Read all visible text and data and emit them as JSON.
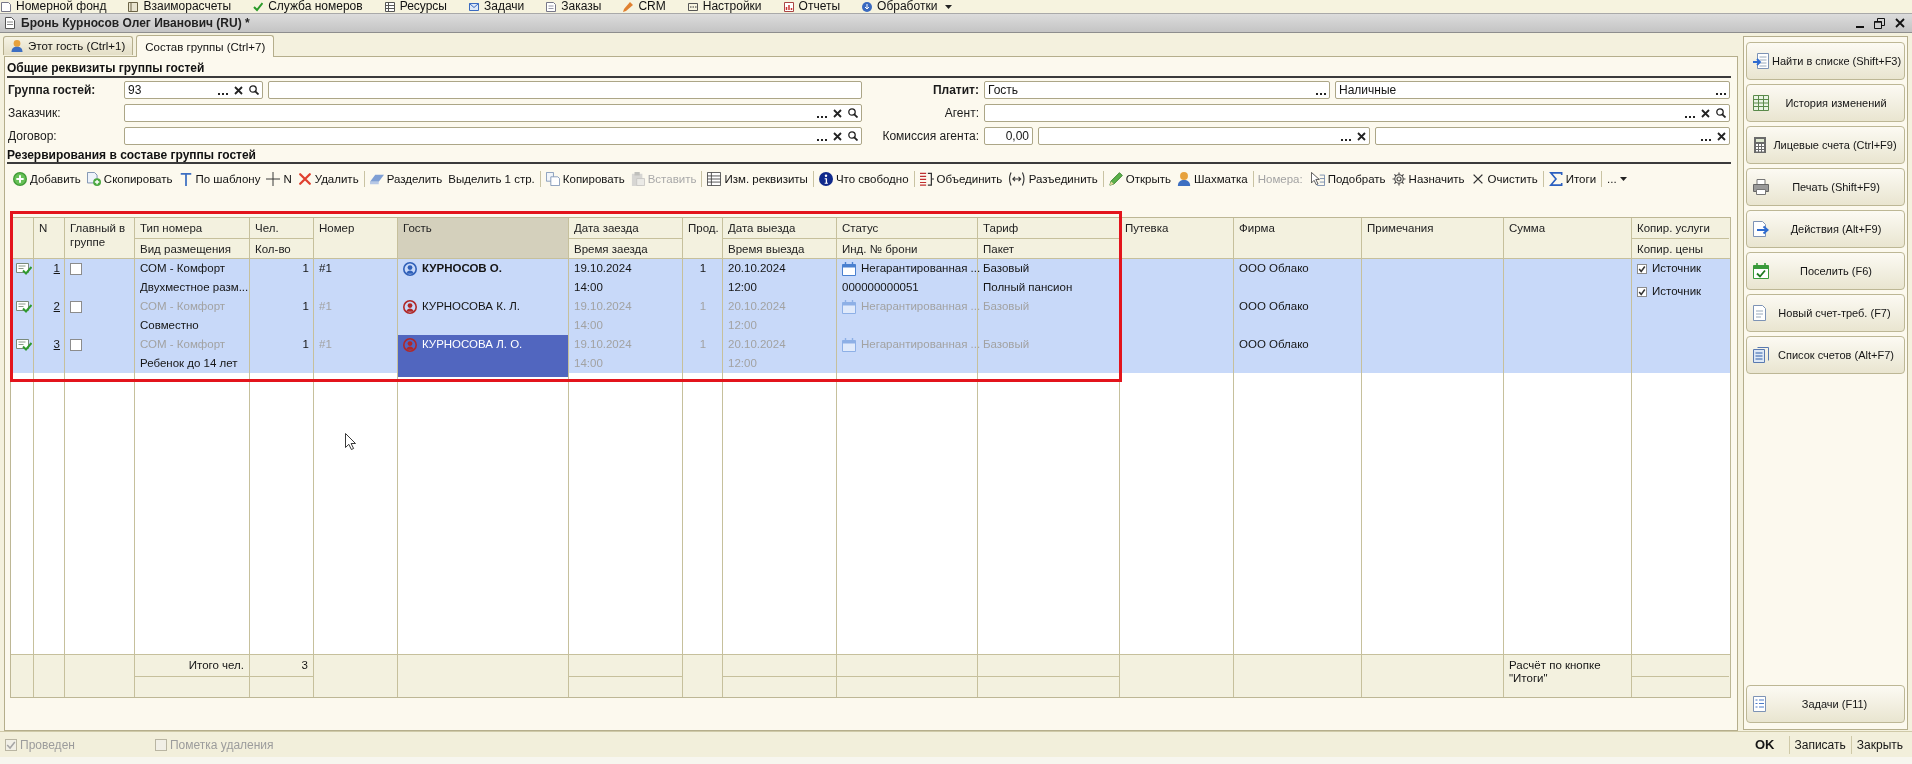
{
  "menu_bar": {
    "items": [
      {
        "label": "Номерной фонд"
      },
      {
        "label": "Взаиморасчеты"
      },
      {
        "label": "Служба номеров"
      },
      {
        "label": "Ресурсы"
      },
      {
        "label": "Задачи"
      },
      {
        "label": "Заказы"
      },
      {
        "label": "CRM"
      },
      {
        "label": "Настройки"
      },
      {
        "label": "Отчеты"
      },
      {
        "label": "Обработки"
      }
    ]
  },
  "window": {
    "title": "Бронь Курносов Олег Иванович (RU) *"
  },
  "tabs": [
    {
      "label": "Этот гость (Ctrl+1)",
      "selected": false
    },
    {
      "label": "Состав группы (Ctrl+7)",
      "selected": true
    }
  ],
  "group_details": {
    "title": "Общие реквизиты группы гостей",
    "left": [
      {
        "label": "Группа гостей:",
        "emphasized": true,
        "inputs": [
          {
            "kind": "lookup",
            "value": "93"
          },
          {
            "kind": "plain"
          }
        ]
      },
      {
        "label": "Заказчик:",
        "emphasized": false,
        "inputs": [
          {
            "kind": "lookup"
          }
        ]
      },
      {
        "label": "Договор:",
        "emphasized": false,
        "inputs": [
          {
            "kind": "lookup"
          }
        ]
      }
    ],
    "right": [
      {
        "label": "Платит:",
        "emphasized": true,
        "inputs": [
          {
            "kind": "select",
            "value": "Гость"
          },
          {
            "kind": "select",
            "value": "Наличные"
          }
        ]
      },
      {
        "label": "Агент:",
        "emphasized": false,
        "inputs": [
          {
            "kind": "lookup"
          }
        ]
      },
      {
        "label": "Комиссия агента:",
        "emphasized": false,
        "inputs": [
          {
            "kind": "number",
            "value": "0,00"
          },
          {
            "kind": "link"
          },
          {
            "kind": "link"
          }
        ]
      }
    ]
  },
  "reservations": {
    "title": "Резервирования в составе группы гостей",
    "toolbar": {
      "groups": [
        {
          "items": [
            {
              "kind": "button",
              "label": "Добавить",
              "disabled": false
            },
            {
              "kind": "button",
              "label": "Скопировать",
              "disabled": false
            },
            {
              "kind": "button",
              "label": "По шаблону",
              "disabled": false
            },
            {
              "kind": "button",
              "label": "N",
              "disabled": false
            },
            {
              "kind": "button",
              "label": "Удалить",
              "disabled": false
            }
          ]
        },
        {
          "items": [
            {
              "kind": "button",
              "label": "Разделить",
              "disabled": false
            },
            {
              "kind": "button",
              "label": "Выделить 1 стр.",
              "disabled": false
            }
          ]
        },
        {
          "items": [
            {
              "kind": "button",
              "label": "Копировать",
              "disabled": false
            },
            {
              "kind": "button",
              "label": "Вставить",
              "disabled": true
            }
          ]
        },
        {
          "items": [
            {
              "kind": "button",
              "label": "Изм. реквизиты",
              "disabled": false
            }
          ]
        },
        {
          "items": [
            {
              "kind": "button",
              "label": "Что свободно",
              "disabled": false
            }
          ]
        },
        {
          "items": [
            {
              "kind": "button",
              "label": "Объединить",
              "disabled": false
            },
            {
              "kind": "button",
              "label": "Разъединить",
              "disabled": false
            }
          ]
        },
        {
          "items": [
            {
              "kind": "button",
              "label": "Открыть",
              "disabled": false
            },
            {
              "kind": "button",
              "label": "Шахматка",
              "disabled": false
            }
          ]
        },
        {
          "items": [
            {
              "kind": "label",
              "label": "Номера:",
              "disabled": true
            },
            {
              "kind": "button",
              "label": "Подобрать",
              "disabled": false
            },
            {
              "kind": "button",
              "label": "Назначить",
              "disabled": false
            },
            {
              "kind": "button",
              "label": "Очистить",
              "disabled": false
            }
          ]
        },
        {
          "items": [
            {
              "kind": "button",
              "label": "Итоги",
              "disabled": false
            }
          ]
        },
        {
          "items": [
            {
              "kind": "menu",
              "label": "...",
              "disabled": false
            }
          ]
        }
      ]
    },
    "table": {
      "columns": [
        {
          "label": "N",
          "selected": false
        },
        {
          "label": "Главный в группе",
          "selected": false
        },
        {
          "label": "Тип номера",
          "sublabel": "Вид размещения",
          "selected": false
        },
        {
          "label": "Чел.",
          "sublabel": "Кол-во",
          "selected": false
        },
        {
          "label": "Номер",
          "selected": false
        },
        {
          "label": "Гость",
          "selected": true
        },
        {
          "label": "Дата заезда",
          "sublabel": "Время заезда",
          "selected": false
        },
        {
          "label": "Прод.",
          "selected": false
        },
        {
          "label": "Дата выезда",
          "sublabel": "Время выезда",
          "selected": false
        },
        {
          "label": "Статус",
          "sublabel": "Инд. № брони",
          "selected": false
        },
        {
          "label": "Тариф",
          "sublabel": "Пакет",
          "selected": false
        },
        {
          "label": "Путевка",
          "selected": false
        },
        {
          "label": "Фирма",
          "selected": false
        },
        {
          "label": "Примечания",
          "selected": false
        },
        {
          "label": "Сумма",
          "selected": false
        },
        {
          "label": "Копир. услуги",
          "sublabel": "Копир. цены",
          "selected": false
        }
      ],
      "rows": [
        {
          "selected": true,
          "dimmed": false,
          "n": "1",
          "main_in_group": false,
          "room_type": "СОМ - Комфорт",
          "accommodation": "Двухместное разм...",
          "persons": "1",
          "room": "#1",
          "guest": {
            "name": "КУРНОСОВ О.",
            "color": "#3060b8",
            "emphasized": true,
            "focused": false
          },
          "arrival_date": "19.10.2024",
          "arrival_time": "14:00",
          "duration": "1",
          "departure_date": "20.10.2024",
          "departure_time": "12:00",
          "status": "Негарантированная ...",
          "booking_no": "000000000051",
          "tariff": "Базовый",
          "package": "Полный пансион",
          "firm": "ООО Облако",
          "copy_services": {
            "checked": true,
            "label": "Источник"
          },
          "copy_prices": {
            "checked": true,
            "label": "Источник"
          }
        },
        {
          "selected": true,
          "dimmed": true,
          "n": "2",
          "main_in_group": false,
          "room_type": "СОМ - Комфорт",
          "accommodation": "Совместно",
          "persons": "1",
          "room": "#1",
          "guest": {
            "name": "КУРНОСОВА К. Л.",
            "color": "#b02828",
            "emphasized": false,
            "focused": false
          },
          "arrival_date": "19.10.2024",
          "arrival_time": "14:00",
          "duration": "1",
          "departure_date": "20.10.2024",
          "departure_time": "12:00",
          "status": "Негарантированная ...",
          "tariff": "Базовый",
          "firm": "ООО Облако"
        },
        {
          "selected": true,
          "dimmed": true,
          "n": "3",
          "main_in_group": false,
          "room_type": "СОМ - Комфорт",
          "accommodation": "Ребенок до 14 лет",
          "persons": "1",
          "room": "#1",
          "guest": {
            "name": "КУРНОСОВА Л. О.",
            "color": "#b02828",
            "emphasized": false,
            "focused": true
          },
          "arrival_date": "19.10.2024",
          "arrival_time": "14:00",
          "duration": "1",
          "departure_date": "20.10.2024",
          "departure_time": "12:00",
          "status": "Негарантированная ...",
          "tariff": "Базовый",
          "firm": "ООО Облако"
        }
      ],
      "footer": {
        "total_label": "Итого чел.",
        "total_persons": "3",
        "sum_note": "Расчёт по кнопке \"Итоги\""
      }
    }
  },
  "sidebar": {
    "buttons": [
      {
        "label": "Найти в списке (Shift+F3)"
      },
      {
        "label": "История изменений"
      },
      {
        "label": "Лицевые счета (Ctrl+F9)"
      },
      {
        "label": "Печать (Shift+F9)"
      },
      {
        "label": "Действия (Alt+F9)"
      },
      {
        "label": "Поселить (F6)"
      },
      {
        "label": "Новый счет-треб. (F7)"
      },
      {
        "label": "Список счетов (Alt+F7)"
      }
    ],
    "bottom_buttons": [
      {
        "label": "Задачи (F11)"
      }
    ]
  },
  "status_bar": {
    "checkboxes": [
      {
        "label": "Проведен",
        "checked": true,
        "disabled": true
      },
      {
        "label": "Пометка удаления",
        "checked": false,
        "disabled": true
      }
    ],
    "buttons": [
      {
        "label": "OK",
        "default": true
      },
      {
        "label": "Записать",
        "default": false
      },
      {
        "label": "Закрыть",
        "default": false
      }
    ]
  }
}
